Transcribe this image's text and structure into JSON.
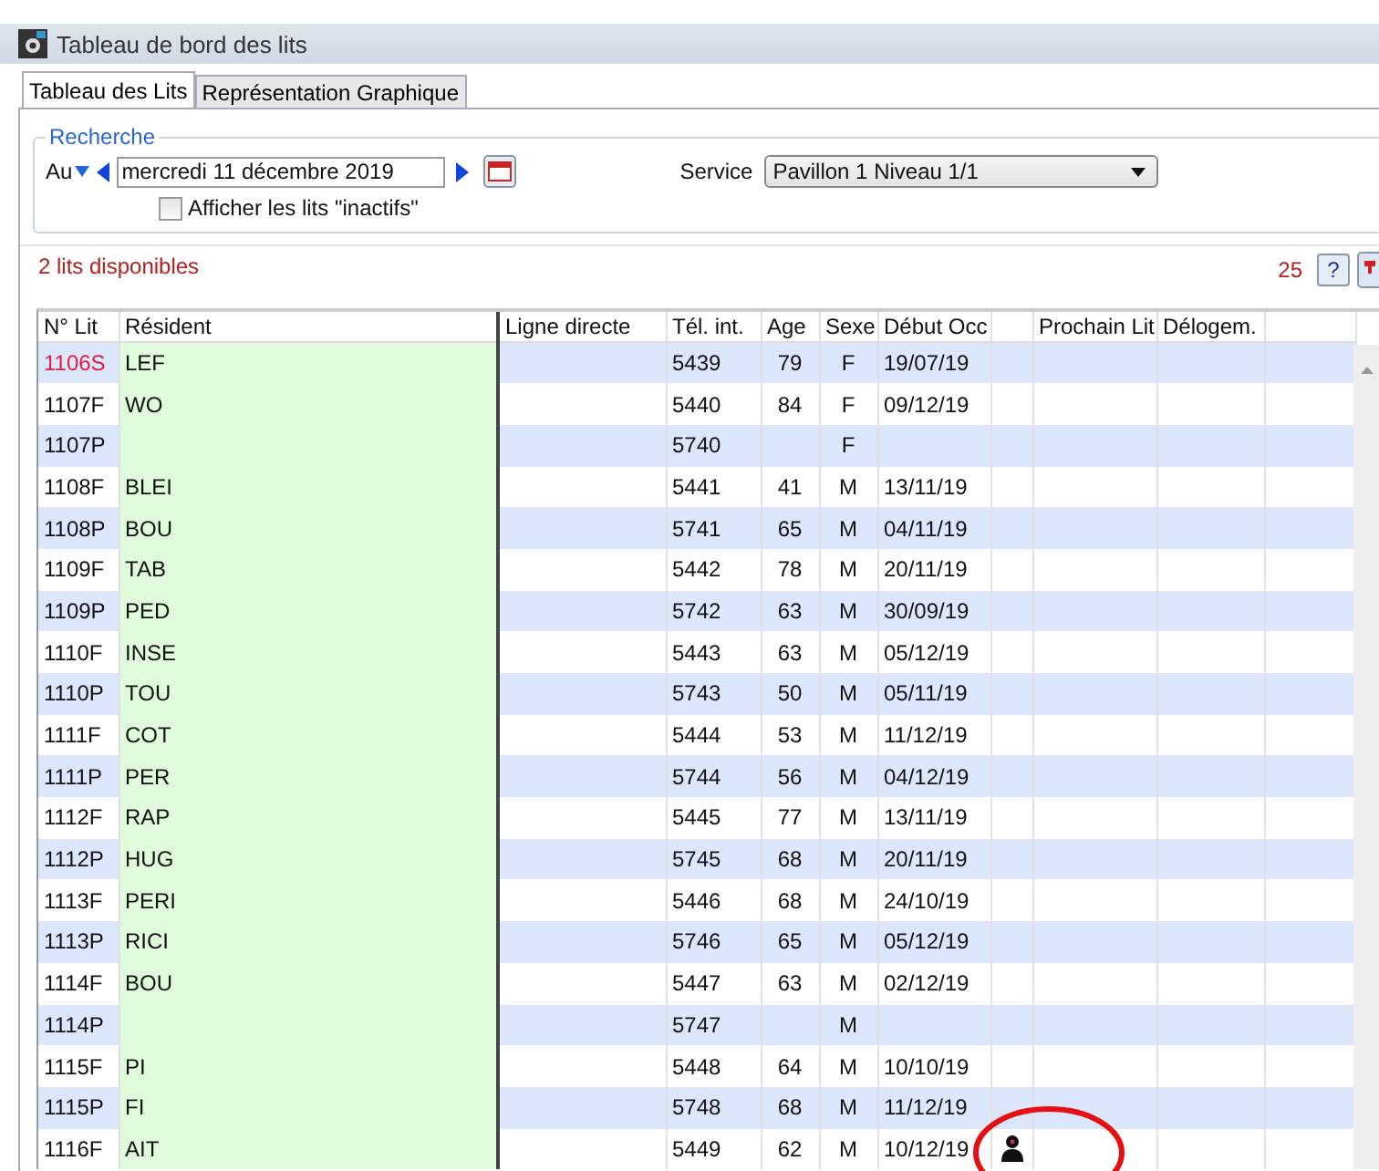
{
  "window": {
    "title": "Tableau de bord des lits"
  },
  "tabs": [
    {
      "label": "Tableau des Lits",
      "selected": true
    },
    {
      "label": "Représentation Graphique",
      "selected": false
    }
  ],
  "search": {
    "legend": "Recherche",
    "mode": "Au",
    "date": "mercredi 11 décembre 2019",
    "show_inactive": {
      "label": "Afficher les lits \"inactifs\"",
      "checked": false
    },
    "service_label": "Service",
    "service": "Pavillon 1 Niveau 1/1"
  },
  "available": "2 lits disponibles",
  "count": "25",
  "help": "?",
  "table": {
    "columns": [
      "N° Lit",
      "Résident",
      "Ligne directe",
      "Tél. int.",
      "Age",
      "Sexe",
      "Début Occ",
      "",
      "Prochain Lit",
      "Délogem."
    ],
    "rows": [
      {
        "bed": "1106S",
        "alert": true,
        "resident": "LEF",
        "line": "",
        "tel": "5439",
        "age": "79",
        "sex": "F",
        "start": "19/07/19",
        "person_icon": false
      },
      {
        "bed": "1107F",
        "alert": false,
        "resident": "WO",
        "line": "",
        "tel": "5440",
        "age": "84",
        "sex": "F",
        "start": "09/12/19",
        "person_icon": false
      },
      {
        "bed": "1107P",
        "alert": false,
        "resident": "",
        "line": "",
        "tel": "5740",
        "age": "",
        "sex": "F",
        "start": "",
        "person_icon": false
      },
      {
        "bed": "1108F",
        "alert": false,
        "resident": "BLEI",
        "line": "",
        "tel": "5441",
        "age": "41",
        "sex": "M",
        "start": "13/11/19",
        "person_icon": false
      },
      {
        "bed": "1108P",
        "alert": false,
        "resident": "BOU",
        "line": "",
        "tel": "5741",
        "age": "65",
        "sex": "M",
        "start": "04/11/19",
        "person_icon": false
      },
      {
        "bed": "1109F",
        "alert": false,
        "resident": "TAB",
        "line": "",
        "tel": "5442",
        "age": "78",
        "sex": "M",
        "start": "20/11/19",
        "person_icon": false
      },
      {
        "bed": "1109P",
        "alert": false,
        "resident": "PED",
        "line": "",
        "tel": "5742",
        "age": "63",
        "sex": "M",
        "start": "30/09/19",
        "person_icon": false
      },
      {
        "bed": "1110F",
        "alert": false,
        "resident": "INSE",
        "line": "",
        "tel": "5443",
        "age": "63",
        "sex": "M",
        "start": "05/12/19",
        "person_icon": false
      },
      {
        "bed": "1110P",
        "alert": false,
        "resident": "TOU",
        "line": "",
        "tel": "5743",
        "age": "50",
        "sex": "M",
        "start": "05/11/19",
        "person_icon": false
      },
      {
        "bed": "1111F",
        "alert": false,
        "resident": "COT",
        "line": "",
        "tel": "5444",
        "age": "53",
        "sex": "M",
        "start": "11/12/19",
        "person_icon": false
      },
      {
        "bed": "1111P",
        "alert": false,
        "resident": "PER",
        "line": "",
        "tel": "5744",
        "age": "56",
        "sex": "M",
        "start": "04/12/19",
        "person_icon": false
      },
      {
        "bed": "1112F",
        "alert": false,
        "resident": "RAP",
        "line": "",
        "tel": "5445",
        "age": "77",
        "sex": "M",
        "start": "13/11/19",
        "person_icon": false
      },
      {
        "bed": "1112P",
        "alert": false,
        "resident": "HUG",
        "line": "",
        "tel": "5745",
        "age": "68",
        "sex": "M",
        "start": "20/11/19",
        "person_icon": false
      },
      {
        "bed": "1113F",
        "alert": false,
        "resident": "PERI",
        "line": "",
        "tel": "5446",
        "age": "68",
        "sex": "M",
        "start": "24/10/19",
        "person_icon": false
      },
      {
        "bed": "1113P",
        "alert": false,
        "resident": "RICI",
        "line": "",
        "tel": "5746",
        "age": "65",
        "sex": "M",
        "start": "05/12/19",
        "person_icon": false
      },
      {
        "bed": "1114F",
        "alert": false,
        "resident": "BOU",
        "line": "",
        "tel": "5447",
        "age": "63",
        "sex": "M",
        "start": "02/12/19",
        "person_icon": false
      },
      {
        "bed": "1114P",
        "alert": false,
        "resident": "",
        "line": "",
        "tel": "5747",
        "age": "",
        "sex": "M",
        "start": "",
        "person_icon": false
      },
      {
        "bed": "1115F",
        "alert": false,
        "resident": "PI",
        "line": "",
        "tel": "5448",
        "age": "64",
        "sex": "M",
        "start": "10/10/19",
        "person_icon": false
      },
      {
        "bed": "1115P",
        "alert": false,
        "resident": "FI",
        "line": "",
        "tel": "5748",
        "age": "68",
        "sex": "M",
        "start": "11/12/19",
        "person_icon": false
      },
      {
        "bed": "1116F",
        "alert": false,
        "resident": "AIT",
        "line": "",
        "tel": "5449",
        "age": "62",
        "sex": "M",
        "start": "10/12/19",
        "person_icon": true
      }
    ]
  },
  "annotation": {
    "kind": "ellipse"
  }
}
